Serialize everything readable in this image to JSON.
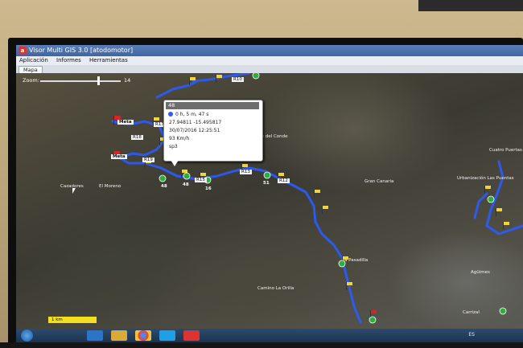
{
  "window": {
    "title": "Visor Multi GIS 3.0 [atodomotor]"
  },
  "menu": {
    "items": [
      "Aplicación",
      "Informes",
      "Herramientas"
    ]
  },
  "tabs": {
    "map_tab": "Mapa"
  },
  "zoom": {
    "label": "Zoom:",
    "value": "14"
  },
  "popup": {
    "id": "48",
    "line_time": "0 h, 5 m, 47 s",
    "line_coords": "27.94811 -15.495817",
    "line_datetime": "30/07/2016 12:25:51",
    "line_speed": "93 Km/h",
    "line_sensor": "sp3"
  },
  "places": {
    "lomo": "Lomo del Conde",
    "cazadores": "Cazadores",
    "moreno": "El Moreno",
    "gran_canaria": "Gran Canaria",
    "urbanizacion": "Urbanización Las Puentas",
    "cuatro": "Cuatro Puertas",
    "pasadilla": "La Pasadilla",
    "camino": "Camino La Orilla",
    "carrizal": "Carrizal",
    "agüimes": "Agüimes"
  },
  "markers": {
    "meta1": "Meta",
    "meta2": "Meta",
    "r17": "R17",
    "r18": "R18",
    "r19": "R19",
    "r15": "R15",
    "r10": "R10",
    "r13": "R13",
    "r12": "R12",
    "n48a": "48",
    "n48b": "48",
    "n51": "51",
    "n16": "16"
  },
  "scale": {
    "label": "1 km"
  },
  "taskbar": {
    "tray_text": "ES"
  },
  "colors": {
    "route": "#2a5cff",
    "flag_yellow": "#f2d530",
    "flag_red": "#d22",
    "pin_green": "#2fae3c"
  }
}
